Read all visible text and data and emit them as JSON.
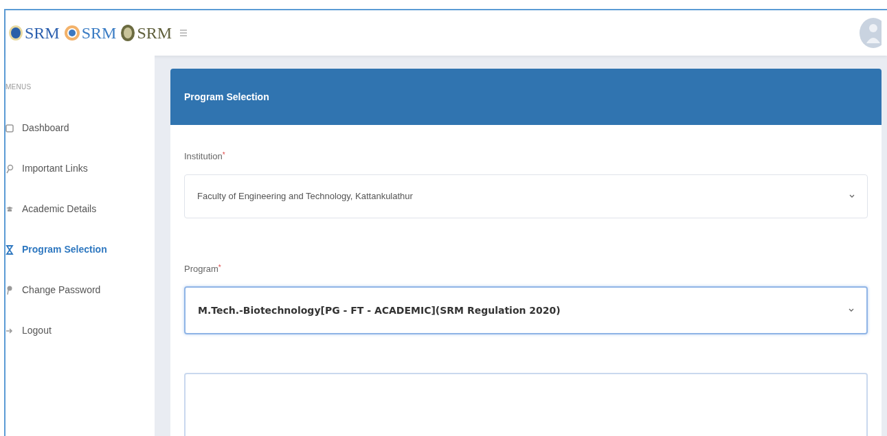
{
  "header": {
    "logos": [
      {
        "kind": "blue",
        "text": "SRM"
      },
      {
        "kind": "sun",
        "text": "SRM"
      },
      {
        "kind": "olive",
        "text": "SRM"
      }
    ]
  },
  "sidebar": {
    "heading": "MENUS",
    "items": [
      {
        "kind": "dashboard",
        "label": "Dashboard",
        "selected": false
      },
      {
        "kind": "link",
        "label": "Important Links",
        "selected": false
      },
      {
        "kind": "academic",
        "label": "Academic Details",
        "selected": false
      },
      {
        "kind": "program",
        "label": "Program Selection",
        "selected": true
      },
      {
        "kind": "password",
        "label": "Change Password",
        "selected": false
      },
      {
        "kind": "logout",
        "label": "Logout",
        "selected": false
      }
    ]
  },
  "card": {
    "title": "Program Selection",
    "fields": [
      {
        "label": "Institution",
        "required_mark": "*",
        "value": "Faculty of Engineering and Technology, Kattankulathur",
        "focused": false
      },
      {
        "label": "Program",
        "required_mark": "*",
        "value": "M.Tech.-Biotechnology[PG - FT - ACADEMIC](SRM Regulation 2020)",
        "focused": true
      }
    ]
  }
}
